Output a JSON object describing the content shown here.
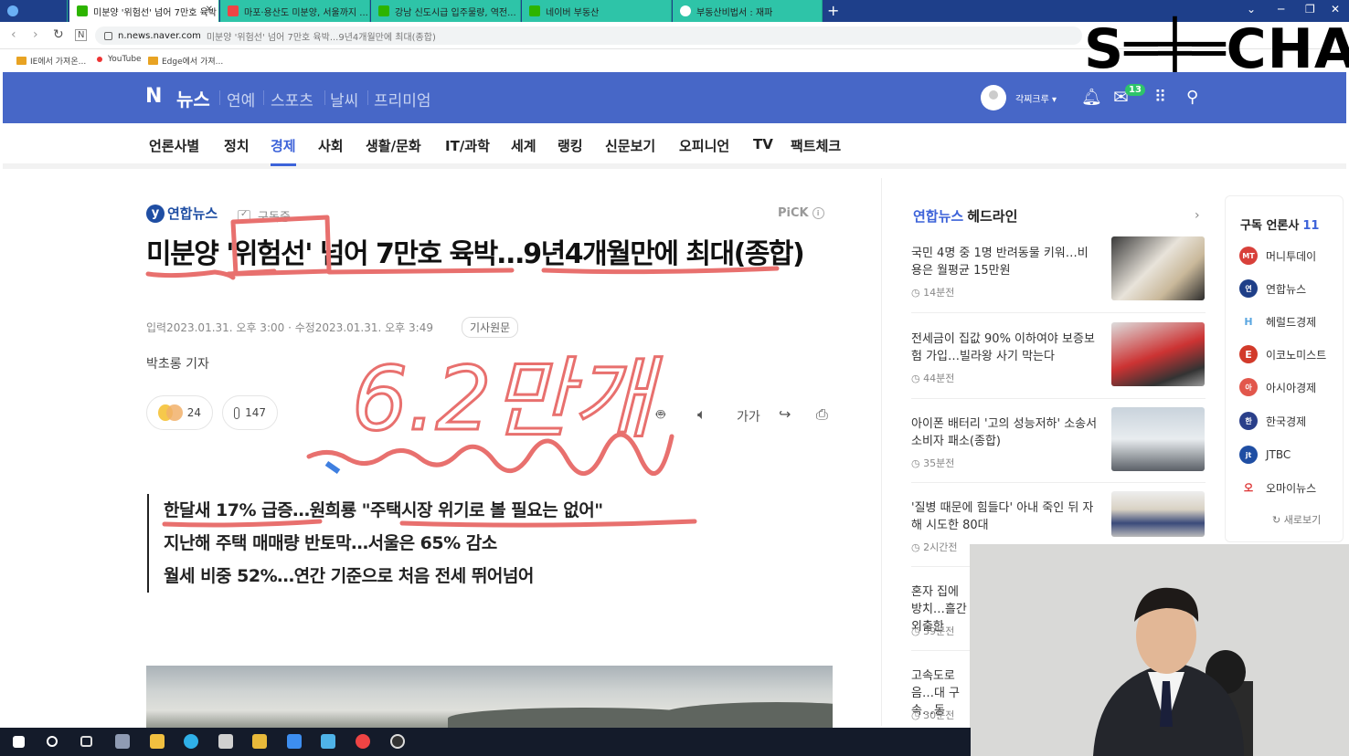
{
  "browser": {
    "tabs": [
      {
        "label": "미분양 '위험선' 넘어 7만호 육박",
        "favicon_color": "#2db400"
      },
      {
        "label": "마포·용산도 미분양, 서울까지 ...",
        "favicon_color": "#e44"
      },
      {
        "label": "강남 신도시급 입주물량, 역전...",
        "favicon_color": "#2db400"
      },
      {
        "label": "네이버 부동산",
        "favicon_color": "#2db400"
      },
      {
        "label": "부동산비법서 : 재파",
        "favicon_color": "#2ec4a8"
      }
    ],
    "new_tab": "+",
    "url_host": "n.news.naver.com",
    "url_rest": "미분양 '위험선' 넘어 7만호 육박...9년4개월만에 최대(종합)",
    "bookmarks": [
      "IE에서 가져온...",
      "YouTube",
      "Edge에서 가져..."
    ]
  },
  "overlay_logo": "S═╪═CHA",
  "naver": {
    "logo": "N",
    "section": "뉴스",
    "top_nav": [
      "연예",
      "스포츠",
      "날씨",
      "프리미엄"
    ],
    "username": "각찌크루",
    "mail_badge": "13",
    "brand_color": "#4767c7"
  },
  "section_nav": {
    "items": [
      "언론사별",
      "정치",
      "경제",
      "사회",
      "생활/문화",
      "IT/과학",
      "세계",
      "랭킹",
      "신문보기",
      "오피니언",
      "TV",
      "팩트체크"
    ],
    "active": "경제",
    "active_color": "#3d63d9"
  },
  "article": {
    "press": "연합뉴스",
    "subscribe_label": "구독중",
    "pick_label": "PiCK",
    "headline": "미분양 '위험선' 넘어 7만호 육박…9년4개월만에 최대(종합)",
    "meta": "입력2023.01.31. 오후 3:00 · 수정2023.01.31. 오후 3:49",
    "origin_label": "기사원문",
    "reporter": "박초롱 기자",
    "reactions": "24",
    "comments": "147",
    "font_size_label": "가가",
    "summary": [
      "한달새 17% 급증…원희룡 \"주택시장 위기로 볼 필요는 없어\"",
      "지난해 주택 매매량 반토막…서울은 65% 감소",
      "월세 비중 52%…연간 기준으로 처음 전세 뛰어넘어"
    ],
    "handwritten_note": "6.2만개"
  },
  "headlines": {
    "press": "연합뉴스",
    "title": "헤드라인",
    "items": [
      {
        "text": "국민 4명 중 1명 반려동물 키워…비용은 월평균 15만원",
        "time": "14분전"
      },
      {
        "text": "전세금이 집값 90% 이하여야 보증보험 가입…빌라왕 사기 막는다",
        "time": "44분전"
      },
      {
        "text": "아이폰 배터리 '고의 성능저하' 소송서 소비자 패소(종합)",
        "time": "35분전"
      },
      {
        "text": "'질병 때문에 힘들다' 아내 죽인 뒤 자해 시도한 80대",
        "time": "2시간전"
      },
      {
        "text": "혼자 집에 방치…흘간 외출한",
        "time": "39분전"
      },
      {
        "text": "고속도로 음…대 구속…동",
        "time": "30분전"
      }
    ]
  },
  "subscribed": {
    "title": "구독 언론사",
    "count": "11",
    "items": [
      {
        "name": "머니투데이",
        "color": "#d8403a",
        "short": "MT"
      },
      {
        "name": "연합뉴스",
        "color": "#1f3f88",
        "short": "연합"
      },
      {
        "name": "헤럴드경제",
        "color": "#ffffff",
        "short": "H"
      },
      {
        "name": "이코노미스트",
        "color": "#d23a2a",
        "short": "E"
      },
      {
        "name": "아시아경제",
        "color": "#e2574c",
        "short": "아경"
      },
      {
        "name": "한국경제",
        "color": "#2a3f8a",
        "short": "한경"
      },
      {
        "name": "JTBC",
        "color": "#1f4ea3",
        "short": "jtbc"
      },
      {
        "name": "오마이뉴스",
        "color": "#ffffff",
        "short": "오"
      }
    ],
    "refresh_label": "새로보기"
  }
}
